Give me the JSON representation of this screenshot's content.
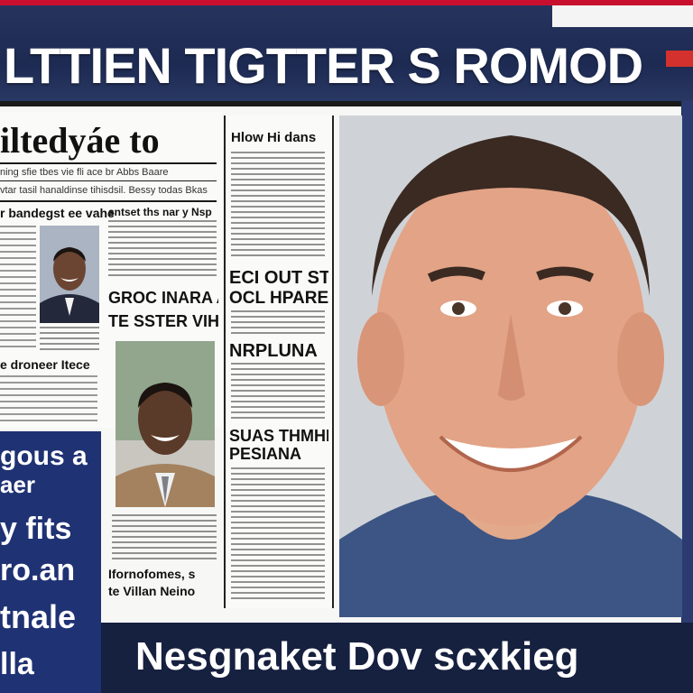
{
  "banner": {
    "headline": "LTTIEN TIGTTER S ROMOD"
  },
  "paper": {
    "masthead": "iltedyáe to",
    "left": {
      "sub1": "ning sfie tbes  vie fli  ace  br  Abbs  Baare",
      "sub2": "vtar tasil hanaldinse tihisdsil.  Bessy todas Bkas",
      "kicker": "r bandegst ee vahe",
      "head2": "e droneer Itece"
    },
    "mid": {
      "head1": "sntset ths nar y Nsp",
      "head2": "GROC INARA A",
      "head3": "TE SSTER VIH",
      "head4": "Ifornofomes, s",
      "head5": "te Villan Neino"
    },
    "narrow": {
      "title": "Hlow Hi dans",
      "h1": "ECI OUT ST",
      "h2": "OCL HPARES",
      "h3": "NRPLUNA",
      "h4": "SUAS THMHE",
      "h5": "PESIANA"
    }
  },
  "side_panel": {
    "lines": [
      "gous a",
      "aer",
      "y fits",
      "ro.an",
      "tnale",
      "lla"
    ]
  },
  "caption": {
    "text": "Nesgnaket Dov scxkieg"
  },
  "colors": {
    "banner_bg": "#1d2a52",
    "accent_red": "#c8102e",
    "side_panel": "#1f3273",
    "caption_bar": "#16203f",
    "paper": "#f7f7f5"
  }
}
